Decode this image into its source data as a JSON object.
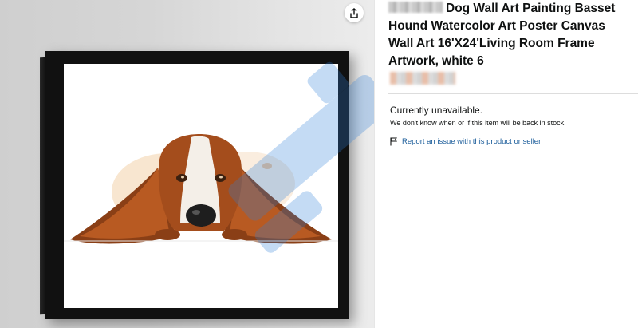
{
  "product": {
    "title_text": "Dog Wall Art Painting Basset Hound Watercolor Art Poster Canvas Wall Art 16'X24'Living Room Frame Artwork, white 6"
  },
  "availability": {
    "status": "Currently unavailable.",
    "note": "We don't know when or if this item will be back in stock.",
    "report_link": "Report an issue with this product or seller"
  },
  "icons": {
    "share": "share-icon",
    "flag": "flag-icon"
  },
  "colors": {
    "link": "#1a5c9a",
    "text": "#0f1111",
    "watermark": "#2f7fd8"
  }
}
